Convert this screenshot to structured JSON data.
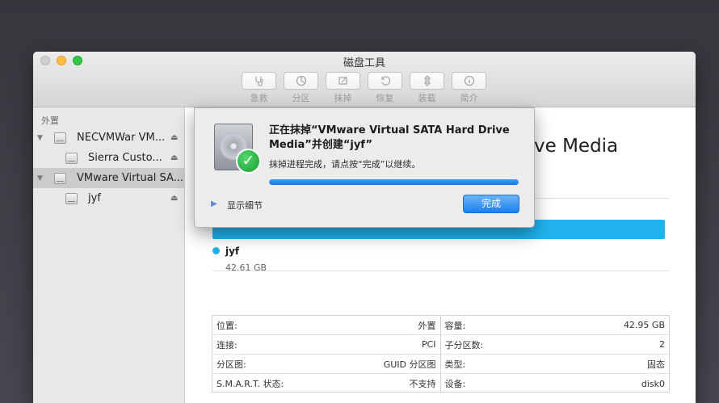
{
  "window": {
    "title": "磁盘工具"
  },
  "toolbar": {
    "items": [
      {
        "label": "急救",
        "icon": "stethoscope-icon"
      },
      {
        "label": "分区",
        "icon": "partition-pie-icon"
      },
      {
        "label": "抹掉",
        "icon": "erase-icon"
      },
      {
        "label": "恢复",
        "icon": "restore-icon"
      },
      {
        "label": "装载",
        "icon": "mount-icon"
      },
      {
        "label": "简介",
        "icon": "info-icon"
      }
    ]
  },
  "sidebar": {
    "section": "外置",
    "items": [
      {
        "label": "NECVMWar VM...",
        "level": 0,
        "expanded": true,
        "eject": true,
        "selected": false
      },
      {
        "label": "Sierra Custo...",
        "level": 1,
        "eject": true,
        "selected": false
      },
      {
        "label": "VMware Virtual SA...",
        "level": 0,
        "expanded": true,
        "eject": false,
        "selected": true
      },
      {
        "label": "jyf",
        "level": 1,
        "eject": true,
        "selected": false
      }
    ]
  },
  "main": {
    "title_visible": "ve Media",
    "partition": {
      "name": "jyf",
      "size": "42.61 GB",
      "color": "#20b3ee"
    },
    "info_left": [
      {
        "label": "位置:",
        "value": "外置"
      },
      {
        "label": "连接:",
        "value": "PCI"
      },
      {
        "label": "分区图:",
        "value": "GUID 分区图"
      },
      {
        "label": "S.M.A.R.T. 状态:",
        "value": "不支持"
      }
    ],
    "info_right": [
      {
        "label": "容量:",
        "value": "42.95 GB"
      },
      {
        "label": "子分区数:",
        "value": "2"
      },
      {
        "label": "类型:",
        "value": "固态"
      },
      {
        "label": "设备:",
        "value": "disk0"
      }
    ]
  },
  "dialog": {
    "title": "正在抹掉“VMware Virtual SATA Hard Drive Media”并创建“jyf”",
    "message": "抹掉进程完成，请点按“完成”以继续。",
    "progress": 1.0,
    "details_label": "显示细节",
    "done_label": "完成"
  }
}
